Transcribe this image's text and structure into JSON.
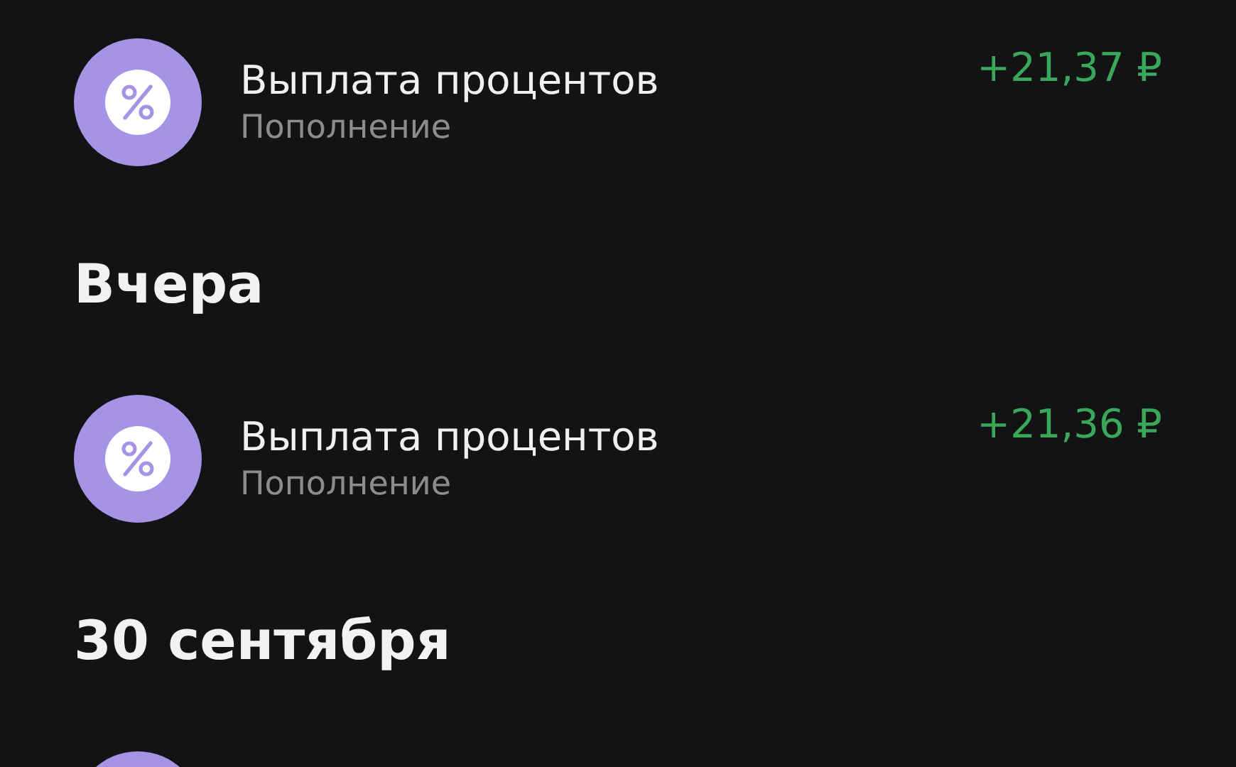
{
  "groups": [
    {
      "items": [
        {
          "kind": "full",
          "title": "Выплата процентов",
          "subtitle": "Пополнение",
          "amount": "+21,37 ₽"
        }
      ]
    },
    {
      "heading": "Вчера",
      "items": [
        {
          "kind": "full",
          "title": "Выплата процентов",
          "subtitle": "Пополнение",
          "amount": "+21,36 ₽"
        }
      ]
    },
    {
      "heading": "30 сентября",
      "items": [
        {
          "kind": "cut"
        }
      ]
    }
  ]
}
